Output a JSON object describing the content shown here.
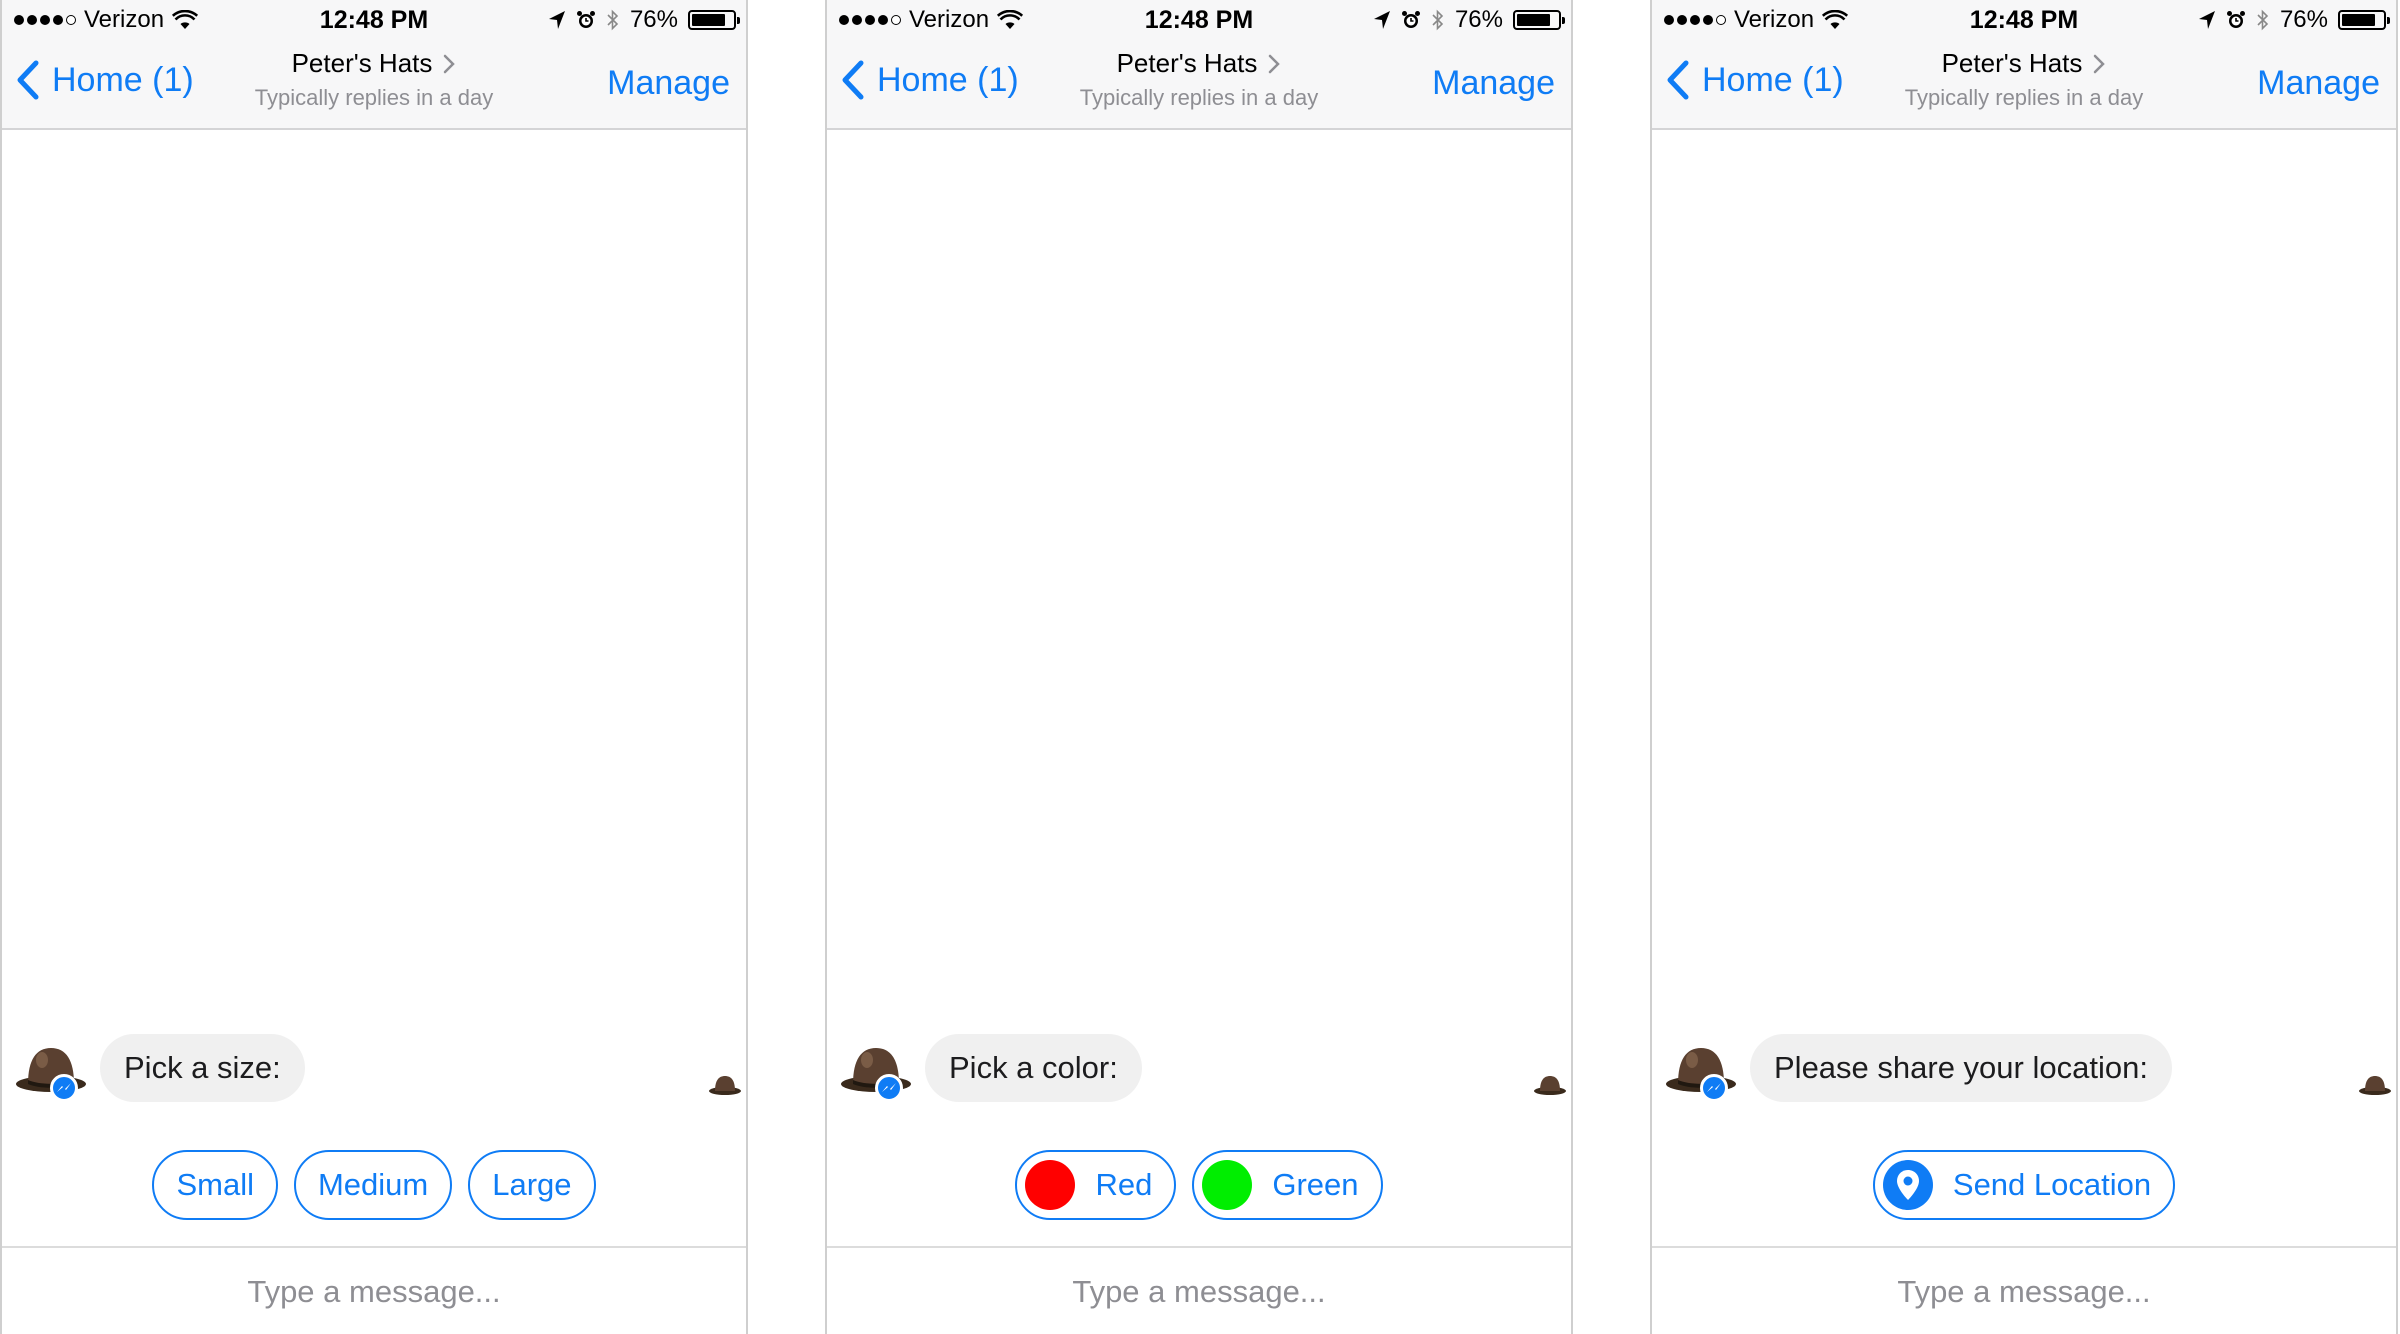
{
  "colors": {
    "accent": "#0f7cf5",
    "red": "#ff0000",
    "green": "#00ee00",
    "bubble": "#f0f0f0"
  },
  "screens": [
    {
      "status": {
        "carrier": "Verizon",
        "time": "12:48 PM",
        "battery_text": "76%",
        "battery_level": 0.76
      },
      "nav": {
        "back_label": "Home (1)",
        "title": "Peter's Hats",
        "subtitle": "Typically replies in a day",
        "right_label": "Manage"
      },
      "message": {
        "text": "Pick a size:"
      },
      "quick_replies": [
        {
          "label": "Small"
        },
        {
          "label": "Medium"
        },
        {
          "label": "Large"
        }
      ],
      "composer": {
        "placeholder": "Type a message..."
      }
    },
    {
      "status": {
        "carrier": "Verizon",
        "time": "12:48 PM",
        "battery_text": "76%",
        "battery_level": 0.76
      },
      "nav": {
        "back_label": "Home (1)",
        "title": "Peter's Hats",
        "subtitle": "Typically replies in a day",
        "right_label": "Manage"
      },
      "message": {
        "text": "Pick a color:"
      },
      "quick_replies": [
        {
          "label": "Red",
          "swatch": "#ff0000"
        },
        {
          "label": "Green",
          "swatch": "#00ee00"
        }
      ],
      "composer": {
        "placeholder": "Type a message..."
      }
    },
    {
      "status": {
        "carrier": "Verizon",
        "time": "12:48 PM",
        "battery_text": "76%",
        "battery_level": 0.76
      },
      "nav": {
        "back_label": "Home (1)",
        "title": "Peter's Hats",
        "subtitle": "Typically replies in a day",
        "right_label": "Manage"
      },
      "message": {
        "text": "Please share your location:"
      },
      "quick_replies": [
        {
          "label": "Send Location",
          "icon": "location-pin-icon"
        }
      ],
      "composer": {
        "placeholder": "Type a message..."
      }
    }
  ]
}
